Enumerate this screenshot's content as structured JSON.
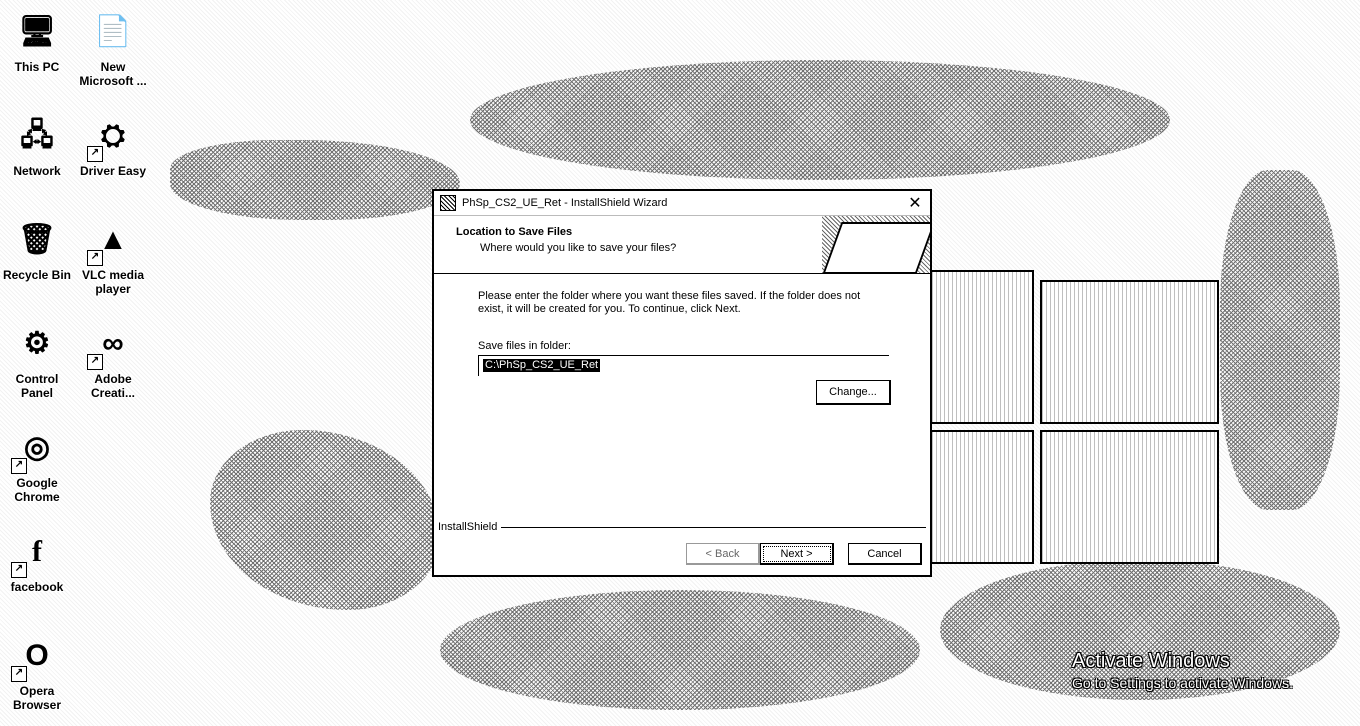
{
  "desktop": {
    "icons": [
      {
        "label": "This PC",
        "icon": "computer-icon",
        "shortcut": false
      },
      {
        "label": "New Microsoft ...",
        "icon": "document-icon",
        "shortcut": false
      },
      {
        "label": "Network",
        "icon": "network-icon",
        "shortcut": false
      },
      {
        "label": "Driver Easy",
        "icon": "driver-easy-icon",
        "shortcut": true
      },
      {
        "label": "Recycle Bin",
        "icon": "recycle-bin-icon",
        "shortcut": false
      },
      {
        "label": "VLC media player",
        "icon": "vlc-icon",
        "shortcut": true
      },
      {
        "label": "Control Panel",
        "icon": "control-panel-icon",
        "shortcut": false
      },
      {
        "label": "Adobe Creati...",
        "icon": "adobe-cc-icon",
        "shortcut": true
      },
      {
        "label": "Google Chrome",
        "icon": "chrome-icon",
        "shortcut": true
      },
      {
        "label": "facebook",
        "icon": "facebook-icon",
        "shortcut": true
      },
      {
        "label": "Opera Browser",
        "icon": "opera-icon",
        "shortcut": true
      }
    ],
    "watermark": {
      "line1": "Activate Windows",
      "line2": "Go to Settings to activate Windows."
    }
  },
  "dialog": {
    "title": "PhSp_CS2_UE_Ret - InstallShield Wizard",
    "close_glyph": "✕",
    "header_title": "Location to Save Files",
    "header_subtitle": "Where would you like to save your files?",
    "description": "Please enter the folder where you want these files saved.  If the folder does not exist, it will be created for you.   To continue, click Next.",
    "folder_label": "Save files in folder:",
    "folder_value": "C:\\PhSp_CS2_UE_Ret",
    "change_label": "Change...",
    "brand": "InstallShield",
    "back_label": "< Back",
    "next_label": "Next >",
    "cancel_label": "Cancel"
  }
}
